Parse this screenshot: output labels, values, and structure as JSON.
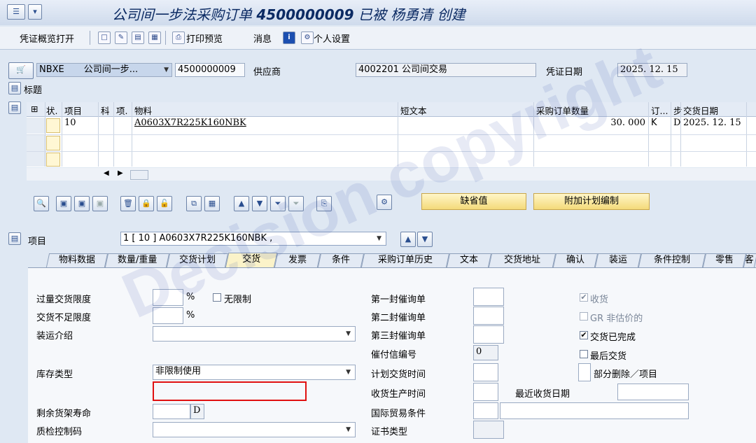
{
  "title": {
    "prefix": "公司间一步法采购订单 ",
    "doc_number": "4500000009",
    "suffix": " 已被 杨勇清 创建"
  },
  "toolbar": {
    "overview": "凭证概览打开",
    "print_preview": "打印预览",
    "messages": "消息",
    "personal_settings": "个人设置"
  },
  "header": {
    "doc_type": "NBXE",
    "doc_type_text": "公司间一步...",
    "po_number": "4500000009",
    "vendor_label": "供应商",
    "vendor_value": "4002201 公司间交易",
    "doc_date_label": "凭证日期",
    "doc_date_value": "2025. 12. 15",
    "section_header": "标题"
  },
  "grid": {
    "columns": {
      "status": "状.",
      "item": "项目",
      "acct": "科",
      "cat": "项.",
      "material": "物料",
      "short_text": "短文本",
      "qty": "采购订单数量",
      "unit": "订...",
      "date_cat": "步",
      "delivery_date": "交货日期"
    },
    "rows": [
      {
        "item": "10",
        "material": "A0603X7R225K160NBK",
        "qty": "30. 000",
        "unit": "K",
        "date_cat": "D",
        "delivery_date": "2025. 12. 15"
      }
    ]
  },
  "buttons": {
    "defaults": "缺省值",
    "additional_planning": "附加计划编制"
  },
  "item": {
    "label": "项目",
    "selected": "1 [ 10 ] A0603X7R225K160NBK ,"
  },
  "tabs": [
    "物料数据",
    "数量/重量",
    "交货计划",
    "交货",
    "发票",
    "条件",
    "采购订单历史",
    "文本",
    "交货地址",
    "确认",
    "装运",
    "条件控制",
    "零售",
    "客户"
  ],
  "delivery": {
    "over_tol": "过量交货限度",
    "over_unit": "%",
    "unlimited": "无限制",
    "under_tol": "交货不足限度",
    "under_unit": "%",
    "shipping_instr": "装运介绍",
    "stock_type": "库存类型",
    "stock_type_value": "非限制使用",
    "shelf_life": "剩余货架寿命",
    "shelf_life_unit": "D",
    "qm_code": "质检控制码",
    "reminder1": "第一封催询单",
    "reminder2": "第二封催询单",
    "reminder3": "第三封催询单",
    "dunning_no": "催付信编号",
    "dunning_no_value": "0",
    "planned_time": "计划交货时间",
    "gr_proc_time": "收货生产时间",
    "last_gr_date": "最近收货日期",
    "incoterms": "国际贸易条件",
    "cert_type": "证书类型",
    "gr": "收货",
    "gr_non_valuated": "GR 非估价的",
    "delivery_complete": "交货已完成",
    "final_delivery": "最后交货",
    "partial_delete": "部分删除／项目"
  },
  "watermark": "Decision copyright"
}
